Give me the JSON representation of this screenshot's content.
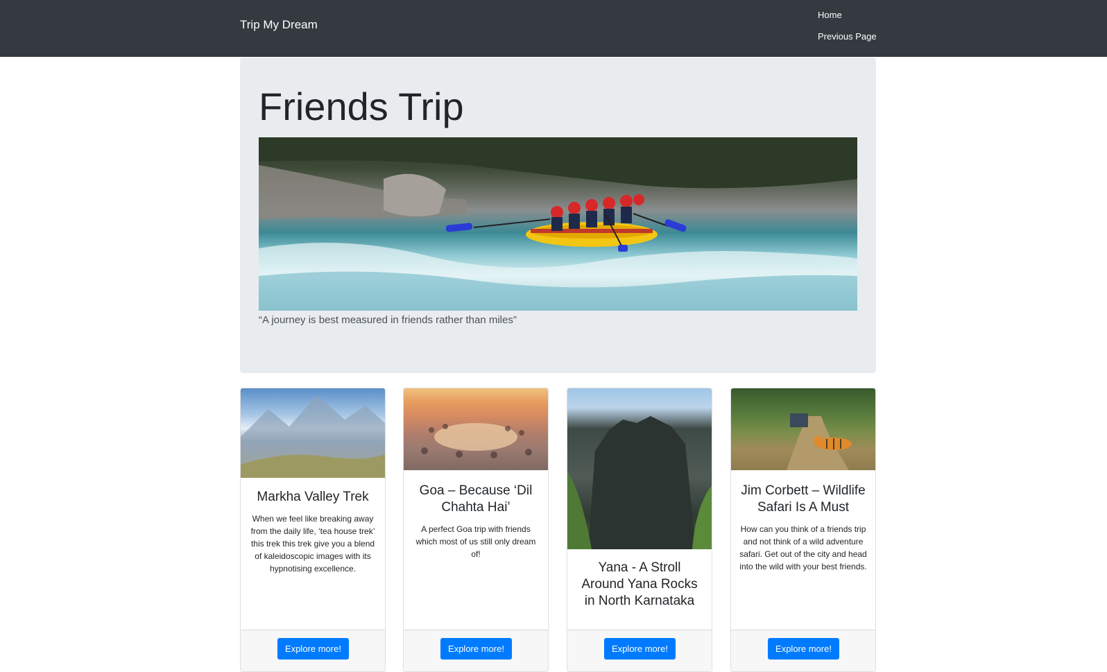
{
  "navbar": {
    "brand": "Trip My Dream",
    "links": [
      "Home",
      "Previous Page"
    ]
  },
  "hero": {
    "title": "Friends Trip",
    "image_alt": "river-rafting-photo",
    "quote": "“A journey is best measured in friends rather than miles”"
  },
  "cards": [
    {
      "title": "Markha Valley Trek",
      "text": "When we feel like breaking away from the daily life, ‘tea house trek’ this trek this trek give you a blend of kaleidoscopic images with its hypnotising excellence.",
      "button": "Explore more!"
    },
    {
      "title": "Goa – Because ‘Dil Chahta Hai’",
      "text": "A perfect Goa trip with friends which most of us still only dream of!",
      "button": "Explore more!"
    },
    {
      "title": "Yana - A Stroll Around Yana Rocks in North Karnataka",
      "text": "",
      "button": "Explore more!"
    },
    {
      "title": "Jim Corbett – Wildlife Safari Is A Must",
      "text": "How can you think of a friends trip and not think of a wild adventure safari. Get out of the city and head into the wild with your best friends.",
      "button": "Explore more!"
    }
  ],
  "colors": {
    "navbar": "#343a40",
    "jumbotron": "#e9ecef",
    "primary_button": "#007bff"
  }
}
